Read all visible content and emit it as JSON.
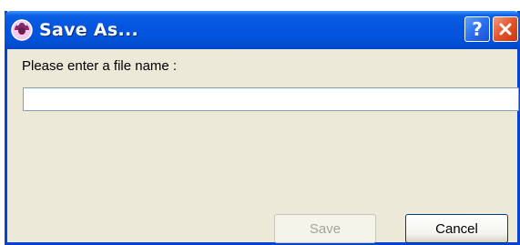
{
  "dialog": {
    "title": "Save As...",
    "app_icon": "app-icon",
    "title_buttons": {
      "help_label": "?",
      "help_icon": "help-icon",
      "close_icon": "close-icon"
    },
    "prompt": "Please enter a file name :",
    "filename_input": {
      "value": "",
      "placeholder": ""
    },
    "buttons": {
      "save_label": "Save",
      "save_enabled": false,
      "cancel_label": "Cancel"
    }
  },
  "colors": {
    "titlebar": "#0555df",
    "dialog_background": "#ece9d8",
    "close_button": "#e3532a",
    "help_button": "#2a6ff0"
  }
}
